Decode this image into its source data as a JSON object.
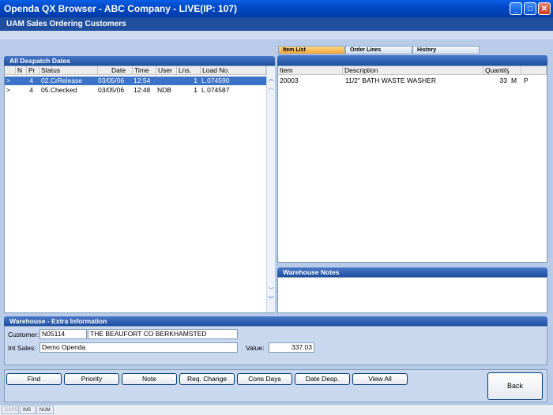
{
  "window": {
    "title": "Openda QX Browser  -  ABC Company - LIVE(IP: 107)"
  },
  "app_header": "UAM Sales Ordering Customers",
  "despatch": {
    "title": "All Despatch Dates",
    "columns": [
      "N",
      "Pr",
      "Status",
      "Date",
      "Time",
      "User",
      "Lns.",
      "Load No."
    ],
    "rows": [
      {
        "marker": ">",
        "pr": "4",
        "status": "02.CrRelease",
        "date": "03/05/06",
        "time": "12:54",
        "user": "",
        "lns": "1",
        "load": "L.074590",
        "selected": true
      },
      {
        "marker": ">",
        "pr": "4",
        "status": "05.Checked",
        "date": "03/05/06",
        "time": "12:48",
        "user": "NDB",
        "lns": "1",
        "load": "L.074587",
        "selected": false
      }
    ]
  },
  "tabs": [
    {
      "label": "Item List",
      "active": true
    },
    {
      "label": "Order Lines",
      "active": false
    },
    {
      "label": "History",
      "active": false
    }
  ],
  "items": {
    "columns": [
      "Item",
      "Description",
      "Quantity"
    ],
    "rows": [
      {
        "item": "20003",
        "description": "11/2\" BATH WASTE WASHER",
        "quantity": "33",
        "unit": "M",
        "flag": "P"
      }
    ]
  },
  "warehouse_notes": {
    "title": "Warehouse Notes"
  },
  "extra": {
    "title": "Warehouse - Extra Information",
    "customer_label": "Customer:",
    "customer_code": "N05114",
    "customer_name": "THE BEAUFORT CO     BERKHAMSTED",
    "int_sales_label": "Int Sales:",
    "int_sales": "Demo Openda",
    "value_label": "Value:",
    "value": "337.03"
  },
  "buttons": [
    "Find",
    "Priority",
    "Note",
    "Req. Change",
    "Cons Days",
    "Date Desp.",
    "View All"
  ],
  "back_button": "Back",
  "status": {
    "caps": "CAPS",
    "ins": "INS",
    "num": "NUM"
  },
  "colors": {
    "title_bar": "#0a5fe6",
    "header": "#1f4f9e",
    "selection": "#3b73c8",
    "active_tab": "#f4a638"
  }
}
